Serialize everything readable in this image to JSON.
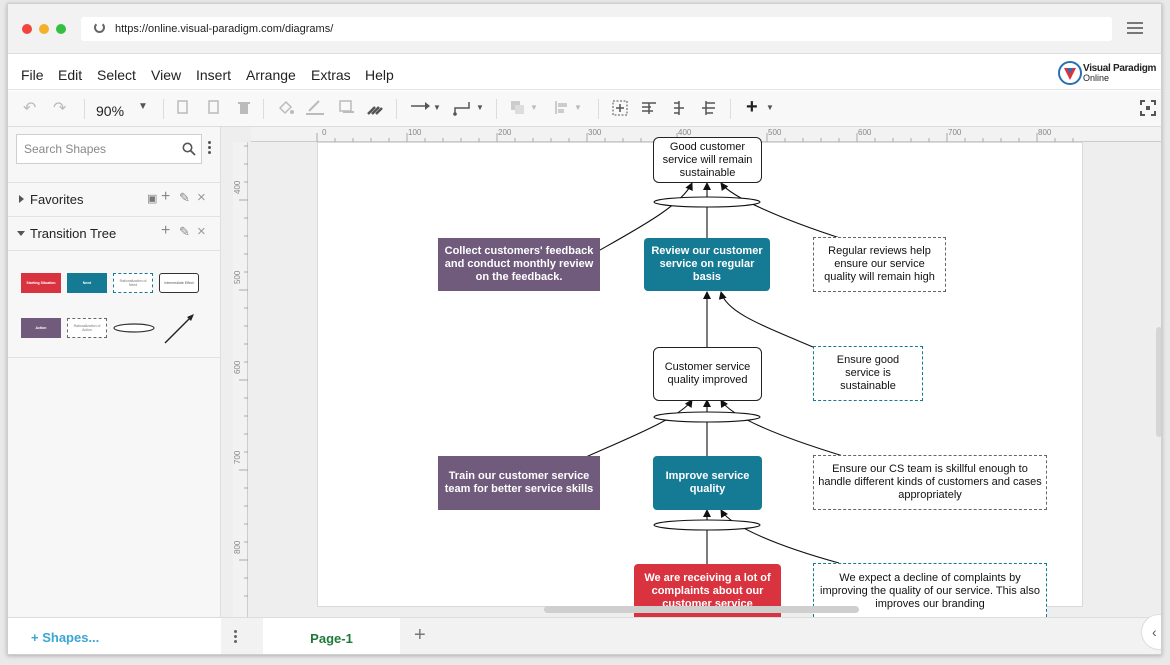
{
  "browser": {
    "url": "https://online.visual-paradigm.com/diagrams/"
  },
  "menu": [
    "File",
    "Edit",
    "Select",
    "View",
    "Insert",
    "Arrange",
    "Extras",
    "Help"
  ],
  "brand": {
    "line1": "Visual Paradigm",
    "line2": "Online"
  },
  "toolbar": {
    "zoom": "90%"
  },
  "sidebar": {
    "search_placeholder": "Search Shapes",
    "favorites": "Favorites",
    "transition_tree": "Transition Tree",
    "palette": {
      "starting": "Starting Situation",
      "need": "Need",
      "rationalization_need": "Rationalization of Need",
      "intermediate": "Intermediate Effect",
      "action": "Action",
      "rationalization_action": "Rationalization of Action"
    },
    "shapes_link": "+ Shapes..."
  },
  "ruler": {
    "top": [
      "0",
      "100",
      "200",
      "300",
      "400",
      "500",
      "600",
      "700",
      "800"
    ],
    "left": [
      "400",
      "500",
      "600",
      "700",
      "800"
    ]
  },
  "diagram": {
    "top_effect": "Good customer service will remain sustainable",
    "collect": "Collect customers' feedback and conduct monthly review on the feedback.",
    "review": "Review our customer service on regular basis",
    "regular_reviews": "Regular reviews help ensure our service quality will remain high",
    "quality_improved": "Customer service quality improved",
    "ensure_good": "Ensure good service is sustainable",
    "train": "Train our customer service team for better service skills",
    "improve": "Improve service quality",
    "ensure_cs": "Ensure our CS team is skillful enough to handle different kinds of customers and cases appropriately",
    "complaints": "We are receiving a lot of complaints about our customer service",
    "expect_decline": "We expect a decline of complaints by improving the quality of our service. This also improves our branding"
  },
  "colors": {
    "action": "#705b7c",
    "need": "#157a93",
    "starting": "#d9333f"
  },
  "pages": {
    "current": "Page-1"
  }
}
